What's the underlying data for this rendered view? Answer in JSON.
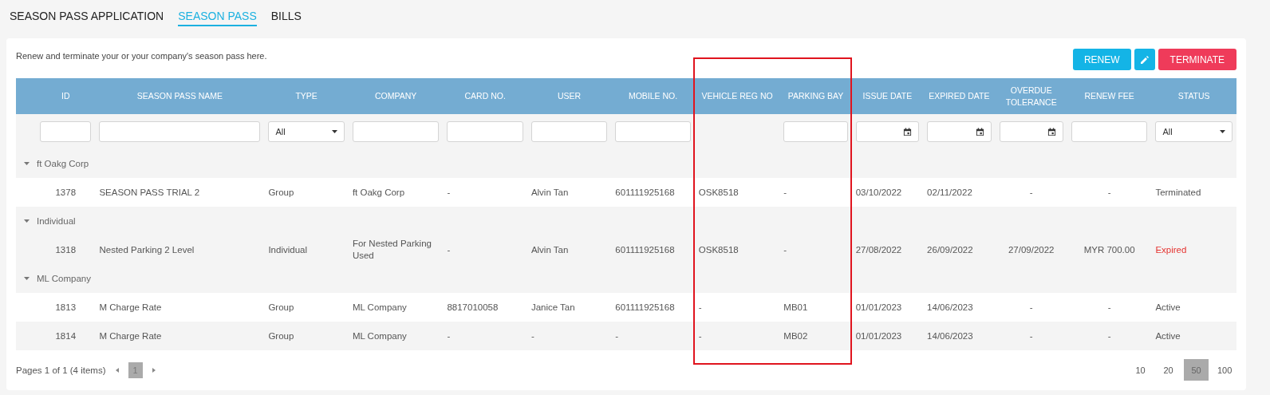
{
  "tabs": [
    {
      "label": "SEASON PASS APPLICATION",
      "selected": false
    },
    {
      "label": "SEASON PASS",
      "selected": true
    },
    {
      "label": "BILLS",
      "selected": false
    }
  ],
  "description": "Renew and terminate your or your company's season pass here.",
  "actions": [
    {
      "kind": "primary",
      "label": "RENEW"
    },
    {
      "kind": "edit"
    },
    {
      "kind": "danger",
      "label": "TERMINATE"
    }
  ],
  "table": {
    "columns": [
      {
        "label": "ID",
        "filter": {
          "kind": "text"
        },
        "highlighted": false
      },
      {
        "label": "SEASON PASS NAME",
        "filter": {
          "kind": "text"
        },
        "highlighted": false
      },
      {
        "label": "TYPE",
        "filter": {
          "kind": "select",
          "value": "All"
        },
        "highlighted": false
      },
      {
        "label": "COMPANY",
        "filter": {
          "kind": "text"
        },
        "highlighted": false
      },
      {
        "label": "CARD NO.",
        "filter": {
          "kind": "text"
        },
        "highlighted": false
      },
      {
        "label": "USER",
        "filter": {
          "kind": "text"
        },
        "highlighted": false
      },
      {
        "label": "MOBILE NO.",
        "filter": {
          "kind": "text"
        },
        "highlighted": false
      },
      {
        "label": "VEHICLE REG NO",
        "highlighted": true
      },
      {
        "label": "PARKING BAY",
        "filter": {
          "kind": "text"
        },
        "highlighted": true
      },
      {
        "label": "ISSUE DATE",
        "filter": {
          "kind": "date"
        },
        "highlighted": false
      },
      {
        "label": "EXPIRED DATE",
        "filter": {
          "kind": "date"
        },
        "highlighted": false
      },
      {
        "label": "OVERDUE TOLERANCE",
        "filter": {
          "kind": "date"
        },
        "highlighted": false
      },
      {
        "label": "RENEW FEE",
        "filter": {
          "kind": "text"
        },
        "highlighted": false
      },
      {
        "label": "STATUS",
        "filter": {
          "kind": "select",
          "value": "All"
        },
        "highlighted": false
      }
    ],
    "groups": [
      {
        "name": "ft Oakg Corp",
        "expanded": true,
        "rows": [
          {
            "cells": [
              "1378",
              "SEASON PASS TRIAL 2",
              "Group",
              "ft Oakg Corp",
              "-",
              "Alvin Tan",
              "601111925168",
              "OSK8518",
              "-",
              "03/10/2022",
              "02/11/2022",
              "-",
              "-",
              "Terminated"
            ],
            "kind": "normal"
          }
        ]
      },
      {
        "name": "Individual",
        "expanded": true,
        "rows": [
          {
            "cells": [
              "1318",
              "Nested Parking 2 Level",
              "Individual",
              "For Nested Parking Used",
              "-",
              "Alvin Tan",
              "601111925168",
              "OSK8518",
              "-",
              "27/08/2022",
              "26/09/2022",
              "27/09/2022",
              "MYR 700.00",
              "Expired"
            ],
            "kind": "alert"
          }
        ]
      },
      {
        "name": "ML Company",
        "expanded": true,
        "rows": [
          {
            "cells": [
              "1813",
              "M Charge Rate",
              "Group",
              "ML Company",
              "8817010058",
              "Janice Tan",
              "601111925168",
              "-",
              "MB01",
              "01/01/2023",
              "14/06/2023",
              "-",
              "-",
              "Active"
            ],
            "kind": "normal"
          },
          {
            "cells": [
              "1814",
              "M Charge Rate",
              "Group",
              "ML Company",
              "-",
              "-",
              "-",
              "-",
              "MB02",
              "01/01/2023",
              "14/06/2023",
              "-",
              "-",
              "Active"
            ],
            "kind": "normal"
          }
        ]
      }
    ]
  },
  "pager": {
    "summary": "Pages 1 of 1 (4 items)",
    "pages": [
      {
        "label": "1",
        "selected": true
      }
    ],
    "sizes": [
      {
        "label": "10",
        "selected": false
      },
      {
        "label": "20",
        "selected": false
      },
      {
        "label": "50",
        "selected": true
      },
      {
        "label": "100",
        "selected": false
      }
    ]
  }
}
